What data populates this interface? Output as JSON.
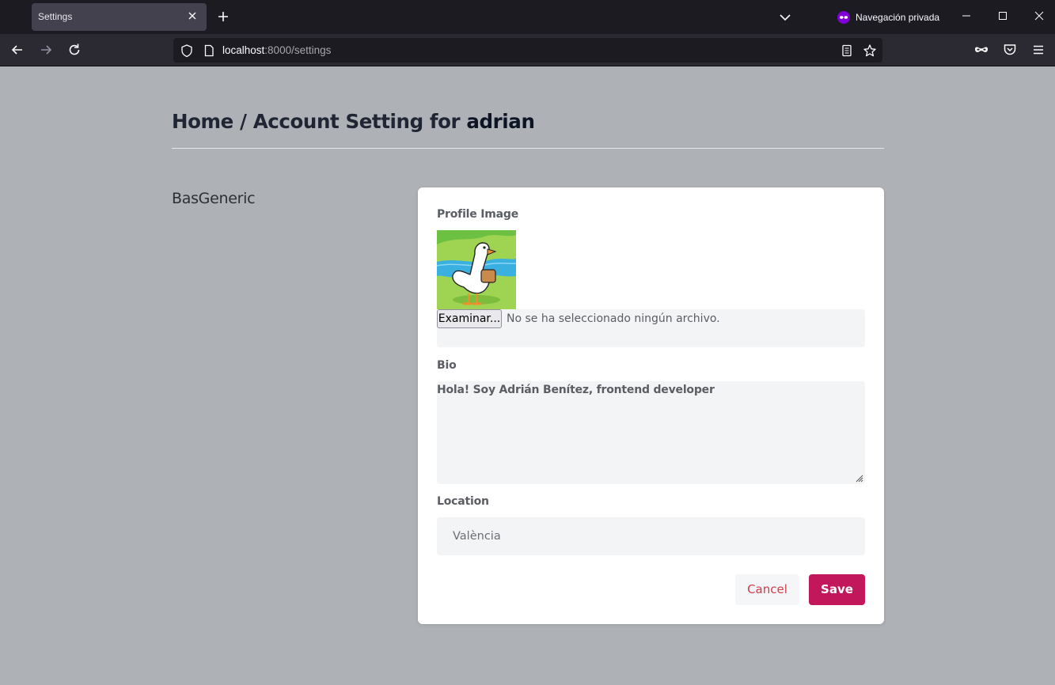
{
  "browser": {
    "tab_title": "Settings",
    "private_label": "Navegación privada",
    "url_host": "localhost",
    "url_path": ":8000/settings"
  },
  "page": {
    "breadcrumb_prefix": "Home / Account Setting for ",
    "username": "adrian",
    "side_label": "BasGeneric"
  },
  "form": {
    "profile_image_label": "Profile Image",
    "file_button_label": "Examinar...",
    "file_status": "No se ha seleccionado ningún archivo.",
    "bio_label": "Bio",
    "bio_value": "Hola! Soy Adrián Benítez, frontend developer",
    "location_label": "Location",
    "location_value": "València",
    "cancel_label": "Cancel",
    "save_label": "Save"
  },
  "colors": {
    "page_bg": "#aeb1b6",
    "save_button": "#c2185b",
    "cancel_text": "#d63a4a"
  }
}
